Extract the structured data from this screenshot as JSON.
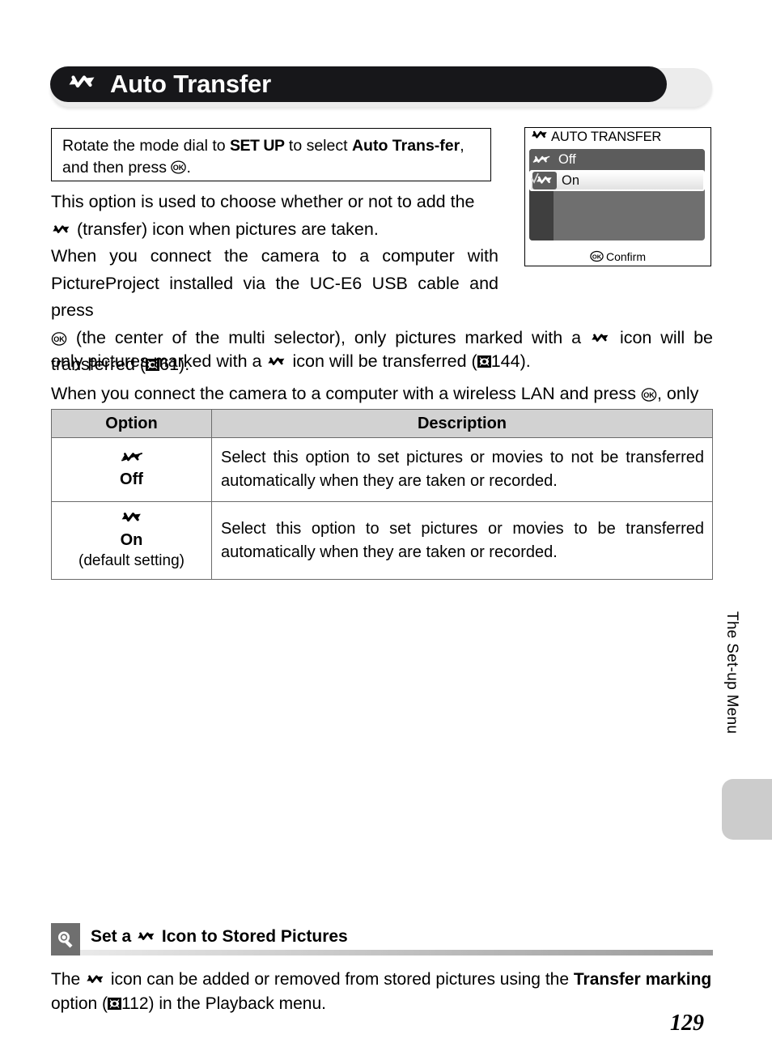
{
  "header": {
    "title": "Auto Transfer",
    "icon": "transfer-icon"
  },
  "instruction": {
    "prefix": "Rotate the mode dial to ",
    "mode_dial_value": "SET UP",
    "middle": " to select ",
    "menu_name": "Auto Trans-fer",
    "menu_name_part1": "Auto Trans-",
    "menu_name_part2": "fer",
    "suffix": ", and then press ",
    "ok_icon": "ok-button-icon",
    "end": "."
  },
  "lcd": {
    "title": "AUTO TRANSFER",
    "title_icon": "transfer-icon",
    "rows": [
      {
        "label": "Off",
        "icon": "transfer-off-icon",
        "selected": false
      },
      {
        "label": "On",
        "icon": "transfer-icon",
        "selected": true,
        "checked": true
      }
    ],
    "footer_button": "ok-button-icon",
    "footer_label": "Confirm"
  },
  "body": {
    "para1_a": "This option is used to choose whether or not to add the ",
    "para1_icon": "transfer-icon",
    "para1_b": " (transfer) icon when pictures are taken.",
    "para2_a": "When you connect the camera to a computer with PictureProject installed via the UC-E6 USB cable and press ",
    "para2_ok": "ok-button-icon",
    "para2_b": " (the center of the multi selector), only pictures marked with a ",
    "para2_icon": "transfer-icon",
    "para2_c": " icon will be transferred (",
    "para2_pageref_icon": "page-reference-icon",
    "para2_pageref": "61",
    "para2_d": ").",
    "para3_a": "When you connect the camera to a computer with a wireless LAN and press ",
    "para3_ok": "ok-button-icon",
    "para3_b": ", only pictures marked with a ",
    "para3_icon": "transfer-icon",
    "para3_c": " icon will be transferred (",
    "para3_pageref_icon": "page-reference-icon",
    "para3_pageref": "144",
    "para3_d": ")."
  },
  "table": {
    "headers": [
      "Option",
      "Description"
    ],
    "rows": [
      {
        "icon": "transfer-off-icon",
        "name": "Off",
        "sub": "",
        "description": "Select this option to set pictures or movies to not be transferred automatically when they are taken or recorded."
      },
      {
        "icon": "transfer-icon",
        "name": "On",
        "sub": "(default setting)",
        "description": "Select this option to set pictures or movies to be transferred automatically when they are taken or recorded."
      }
    ]
  },
  "side": {
    "chapter_label": "The Set-up Menu"
  },
  "tip": {
    "icon": "lightbulb-tip-icon",
    "title_a": "Set a ",
    "title_icon": "transfer-icon",
    "title_b": " Icon to Stored Pictures",
    "body_a": "The ",
    "body_icon": "transfer-icon",
    "body_b": " icon can be added or removed from stored pictures using the ",
    "body_bold": "Transfer marking",
    "body_c": " option (",
    "body_pageref_icon": "page-reference-icon",
    "body_pageref": "112",
    "body_d": ") in the Playback menu."
  },
  "footer": {
    "page_number": "129"
  },
  "colors": {
    "header_bar": "#17171a",
    "header_shadow": "#ececec",
    "table_header_bg": "#d2d2d2",
    "lcd_body_bg": "#6f6f6f",
    "lcd_leftcol_bg": "#3f3f3f",
    "lcd_row_off_bg": "#5c5c5c",
    "side_tab": "#cccccc",
    "tip_icon_bg": "#6f6f6f"
  }
}
